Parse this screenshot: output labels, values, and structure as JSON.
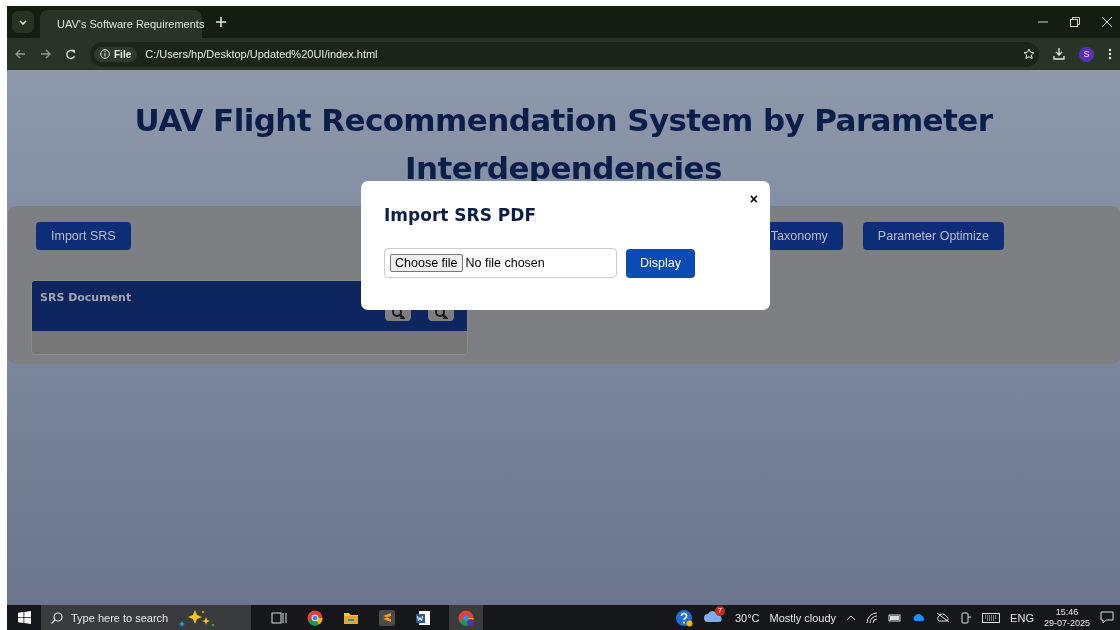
{
  "browser": {
    "tab": {
      "title": "UAV's Software Requirements",
      "selected": true
    },
    "address": {
      "scheme": "File",
      "url": "C:/Users/hp/Desktop/Updated%20UI/index.html"
    },
    "profile": "S"
  },
  "page": {
    "title": "UAV Flight Recommendation System by Parameter Interdependencies",
    "toolbar": [
      {
        "label": "Import SRS"
      },
      {
        "label": "Taxonomy"
      },
      {
        "label": "Parameter Optimize"
      }
    ],
    "document_panel": {
      "title": "SRS Document"
    }
  },
  "dialog": {
    "title": "Import SRS PDF",
    "close": "×",
    "file_button": "Choose file",
    "file_status": "No file chosen",
    "submit": "Display"
  },
  "taskbar": {
    "search_placeholder": "Type here to search",
    "weather_badge": "7",
    "temperature": "30°C",
    "weather": "Mostly cloudy",
    "language": "ENG",
    "time": "15:46",
    "date": "29-07-2025"
  }
}
